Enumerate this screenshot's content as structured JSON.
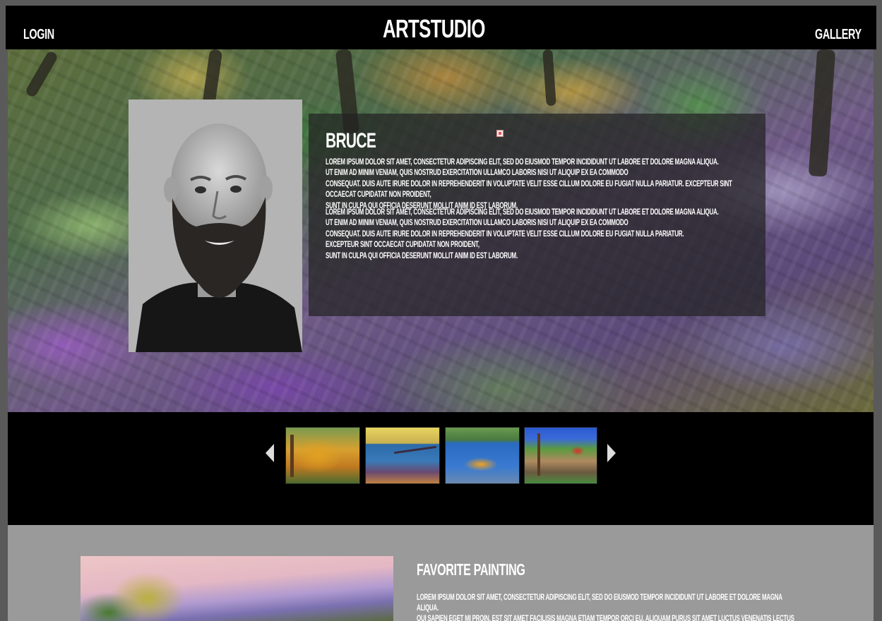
{
  "header": {
    "login_label": "LOGIN",
    "brand": "ARTSTUDIO",
    "gallery_label": "GALLERY"
  },
  "artist": {
    "name": "BRUCE",
    "paragraph_1": "LOREM IPSUM DOLOR SIT AMET, CONSECTETUR ADIPISCING ELIT, SED DO EIUSMOD TEMPOR INCIDIDUNT UT LABORE ET DOLORE MAGNA ALIQUA.\n UT ENIM AD MINIM VENIAM, QUIS NOSTRUD EXERCITATION ULLAMCO LABORIS NISI UT ALIQUIP EX EA COMMODO\nCONSEQUAT. DUIS AUTE IRURE DOLOR IN REPREHENDERIT IN VOLUPTATE VELIT ESSE CILLUM DOLORE EU FUGIAT NULLA PARIATUR. EXCEPTEUR SINT OCCAECAT CUPIDATAT NON PROIDENT,\nSUNT IN CULPA QUI OFFICIA DESERUNT MOLLIT ANIM ID EST LABORUM.",
    "paragraph_2": "LOREM IPSUM DOLOR SIT AMET, CONSECTETUR ADIPISCING ELIT, SED DO EIUSMOD TEMPOR INCIDIDUNT UT LABORE ET DOLORE MAGNA ALIQUA.\n UT ENIM AD MINIM VENIAM, QUIS NOSTRUD EXERCITATION ULLAMCO LABORIS NISI UT ALIQUIP EX EA COMMODO\nCONSEQUAT. DUIS AUTE IRURE DOLOR IN REPREHENDERIT IN VOLUPTATE VELIT ESSE CILLUM DOLORE EU FUGIAT NULLA PARIATUR.\n EXCEPTEUR SINT OCCAECAT CUPIDATAT NON PROIDENT,\nSUNT IN CULPA QUI OFFICIA DESERUNT MOLLIT ANIM ID EST LABORUM."
  },
  "carousel": {
    "prev_icon": "triangle-left-icon",
    "next_icon": "triangle-right-icon",
    "thumbnails": [
      "yellow-house-painting",
      "pier-sunset-painting",
      "seaplane-painting",
      "red-barn-painting"
    ]
  },
  "favorite": {
    "title": "FAVORITE PAINTING",
    "text": "LOREM IPSUM DOLOR SIT AMET, CONSECTETUR ADIPISCING ELIT, SED DO EIUSMOD TEMPOR INCIDIDUNT UT LABORE ET DOLORE MAGNA ALIQUA.\n QUI SAPIEN EGET MI PROIN. EST SIT AMET FACILISIS MAGNA ETIAM TEMPOR ORCI EU. ALIQUAM PURUS SIT AMET LUCTUS VENENATIS LECTUS MAGNA FRINGILLA.\n RISUS IN HENDRERIT GRAVIDA RUTRUM QUISQUE NON TELLUS."
  },
  "colors": {
    "header_bg": "#000000",
    "page_bg": "#5a5a5a",
    "lower_bg": "#9a9a9a",
    "text": "#ffffff"
  }
}
